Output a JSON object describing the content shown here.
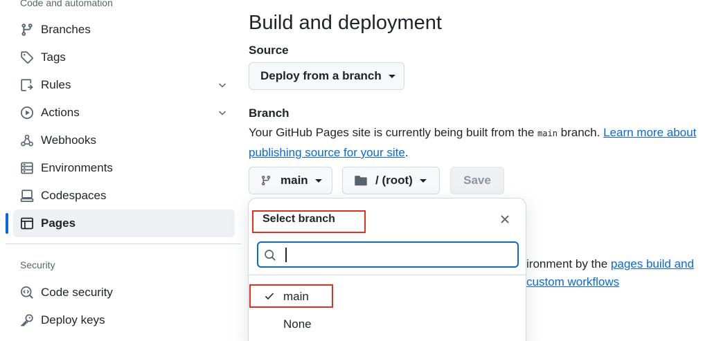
{
  "sidebar": {
    "section_code": "Code and automation",
    "section_security": "Security",
    "items": [
      {
        "label": "Branches",
        "icon": "branch-icon"
      },
      {
        "label": "Tags",
        "icon": "tag-icon"
      },
      {
        "label": "Rules",
        "icon": "rules-icon"
      },
      {
        "label": "Actions",
        "icon": "play-icon"
      },
      {
        "label": "Webhooks",
        "icon": "webhook-icon"
      },
      {
        "label": "Environments",
        "icon": "server-icon"
      },
      {
        "label": "Codespaces",
        "icon": "codespaces-icon"
      },
      {
        "label": "Pages",
        "icon": "browser-icon"
      }
    ],
    "security_items": [
      {
        "label": "Code security",
        "icon": "codescan-icon"
      },
      {
        "label": "Deploy keys",
        "icon": "key-icon"
      }
    ]
  },
  "main": {
    "title": "Build and deployment",
    "source_label": "Source",
    "source_value": "Deploy from a branch",
    "branch_label": "Branch",
    "branch_desc_prefix": "Your GitHub Pages site is currently being built from the ",
    "branch_desc_code": "main",
    "branch_desc_mid": " branch. ",
    "branch_desc_link1": "Learn more about",
    "branch_desc_link2": "publishing source for your site",
    "branch_desc_end": ".",
    "branch_button": "main",
    "folder_button": "/ (root)",
    "save_button": "Save",
    "behind_text_1": "ironment by the ",
    "behind_link_1": "pages build and",
    "behind_link_2": "custom workflows"
  },
  "popover": {
    "title": "Select branch",
    "search_value": "",
    "options": [
      {
        "label": "main",
        "selected": true
      },
      {
        "label": "None",
        "selected": false
      }
    ]
  },
  "colors": {
    "accent": "#0969da",
    "highlight_box": "#e0301e",
    "text": "#1f2328",
    "muted": "#59636e"
  }
}
